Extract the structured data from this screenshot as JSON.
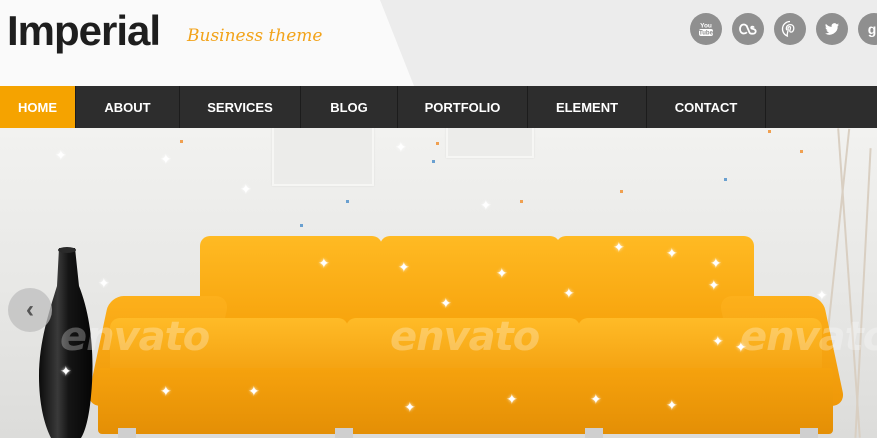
{
  "brand": {
    "name": "Imperial",
    "tagline": "Business theme"
  },
  "social": [
    {
      "name": "youtube-icon",
      "glyph": "You\nTube"
    },
    {
      "name": "lastfm-icon",
      "glyph": "as"
    },
    {
      "name": "pinterest-icon",
      "glyph": "P"
    },
    {
      "name": "twitter-icon",
      "glyph": "t"
    },
    {
      "name": "googleplus-icon",
      "glyph": "g"
    }
  ],
  "nav": {
    "items": [
      {
        "label": "HOME",
        "active": true
      },
      {
        "label": "ABOUT",
        "active": false
      },
      {
        "label": "SERVICES",
        "active": false
      },
      {
        "label": "BLOG",
        "active": false
      },
      {
        "label": "PORTFOLIO",
        "active": false
      },
      {
        "label": "ELEMENT",
        "active": false
      },
      {
        "label": "CONTACT",
        "active": false
      }
    ]
  },
  "slider": {
    "prev_glyph": "‹",
    "watermark_text": "envato"
  },
  "colors": {
    "accent": "#f5a300",
    "nav_bg": "#2d2d2d",
    "icon_bg": "#8f8f8f",
    "logo": "#1e1e1e",
    "tagline": "#f2a31a"
  }
}
